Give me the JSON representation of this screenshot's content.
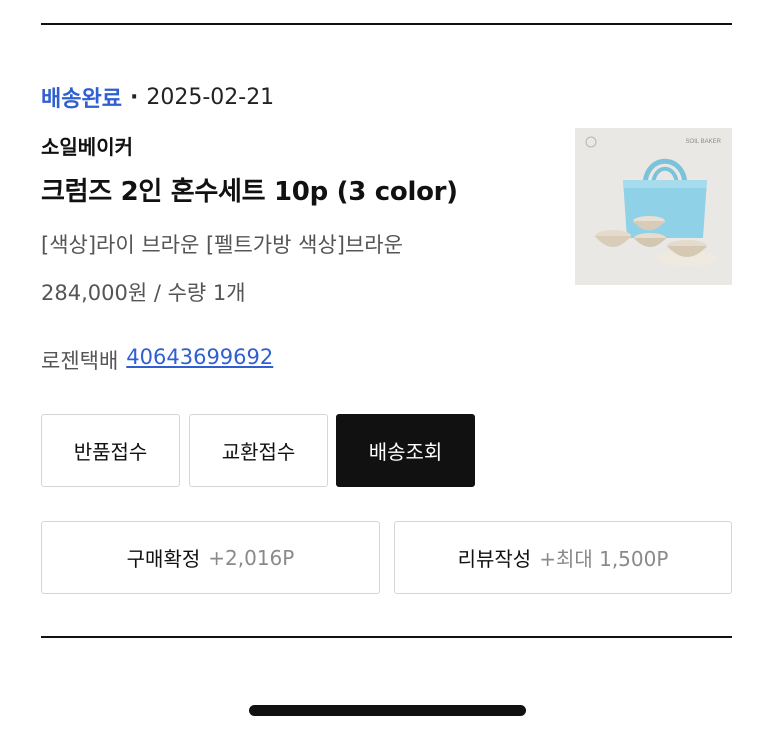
{
  "order": {
    "status": "배송완료",
    "separator": "·",
    "date": "2025-02-21",
    "seller": "소일베이커",
    "product_title": "크럼즈 2인 혼수세트 10p (3 color)",
    "option": "[색상]라이 브라운 [펠트가방 색상]브라운",
    "price_qty": "284,000원 / 수량 1개",
    "courier": "로젠택배",
    "tracking_number": "40643699692",
    "thumbnail": {
      "brand_mark": "SOIL BAKER",
      "bag_color": "#8fd1e6"
    }
  },
  "actions": {
    "return_label": "반품접수",
    "exchange_label": "교환접수",
    "track_label": "배송조회",
    "confirm_label": "구매확정",
    "confirm_points": "+2,016P",
    "review_label": "리뷰작성",
    "review_points": "+최대 1,500P"
  },
  "colors": {
    "accent": "#2f5fd0",
    "dark_button": "#111111"
  }
}
